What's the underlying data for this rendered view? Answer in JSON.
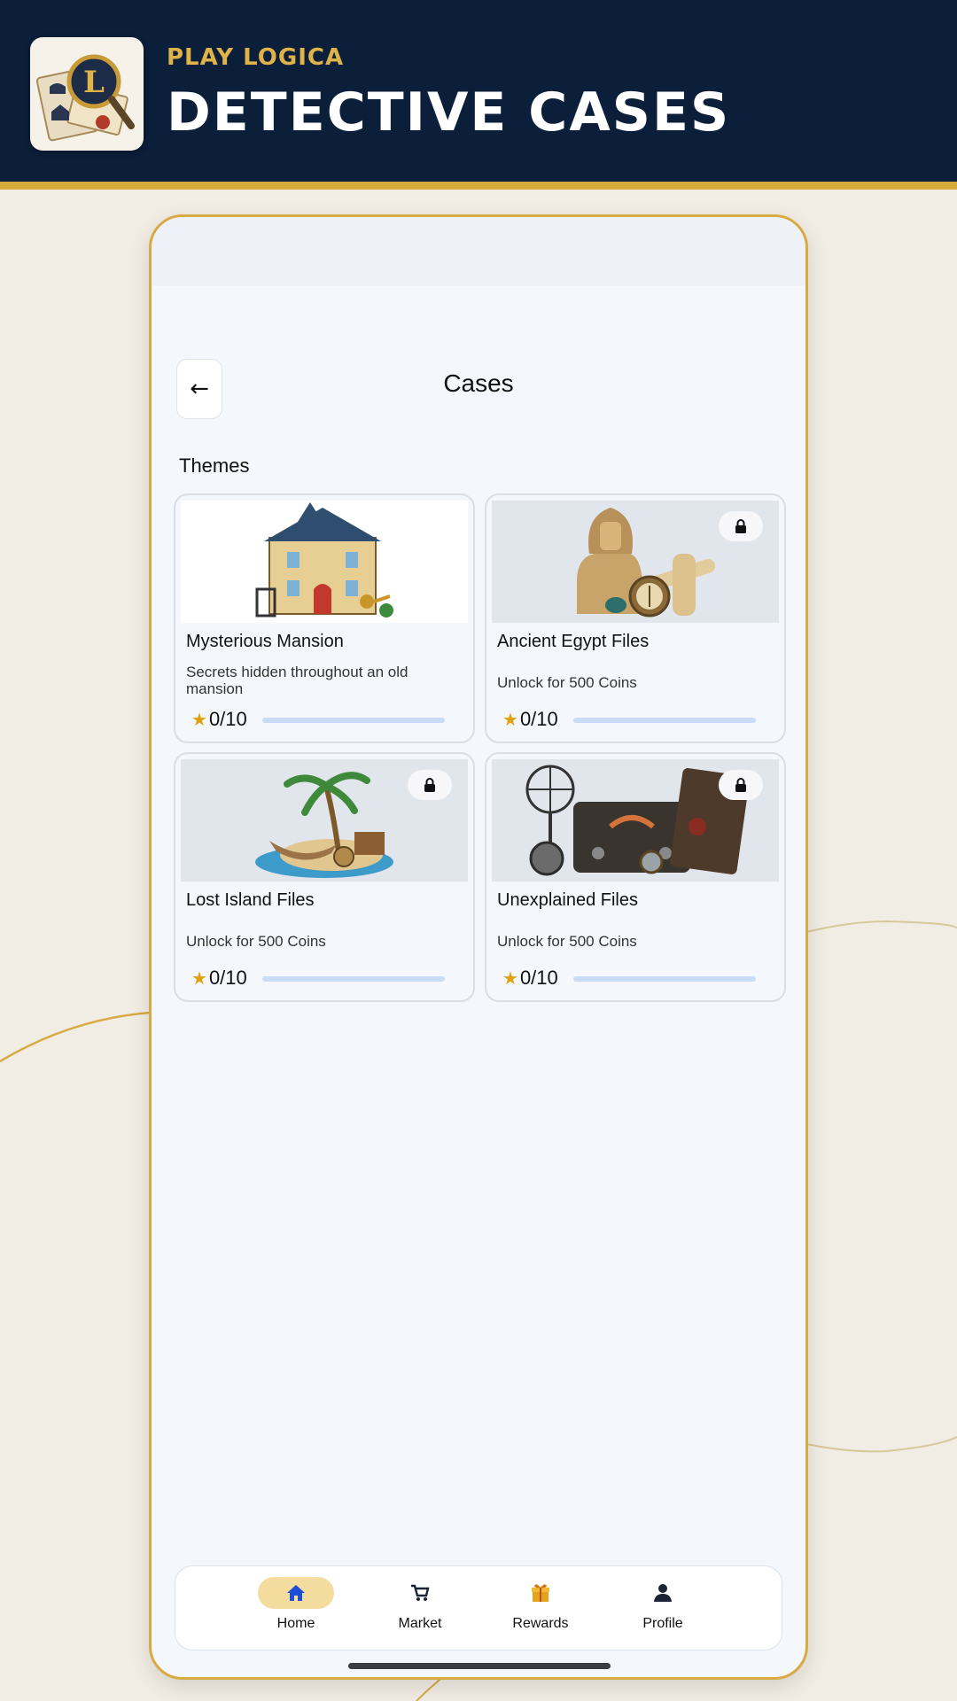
{
  "banner": {
    "brand": "PLAY LOGICA",
    "title": "DETECTIVE CASES",
    "logo_icon": "detective-magnifier-logo-icon"
  },
  "header": {
    "back_icon": "arrow-left-icon",
    "back_glyph": "←",
    "title": "Cases"
  },
  "section_label": "Themes",
  "cases": [
    {
      "title": "Mysterious Mansion",
      "desc": "Secrets hidden throughout an old mansion",
      "locked": false,
      "stars": "0/10",
      "progress": 0,
      "image_icon": "mansion-icon"
    },
    {
      "title": "Ancient Egypt Files",
      "desc": "Unlock for 500 Coins",
      "locked": true,
      "stars": "0/10",
      "progress": 0,
      "image_icon": "sphinx-icon"
    },
    {
      "title": "Lost Island Files",
      "desc": "Unlock for 500 Coins",
      "locked": true,
      "stars": "0/10",
      "progress": 0,
      "image_icon": "island-icon"
    },
    {
      "title": "Unexplained Files",
      "desc": "Unlock for 500 Coins",
      "locked": true,
      "stars": "0/10",
      "progress": 0,
      "image_icon": "radio-equipment-icon"
    }
  ],
  "nav": {
    "items": [
      {
        "label": "Home",
        "icon": "home-icon",
        "active": true
      },
      {
        "label": "Market",
        "icon": "cart-icon",
        "active": false
      },
      {
        "label": "Rewards",
        "icon": "gift-icon",
        "active": false
      },
      {
        "label": "Profile",
        "icon": "person-icon",
        "active": false
      }
    ]
  },
  "colors": {
    "banner_bg": "#0b1e3a",
    "accent_gold": "#d7ab3c",
    "star": "#e0a10c",
    "nav_active_pill": "#f4dc9e",
    "home_icon": "#1d4ed8"
  }
}
